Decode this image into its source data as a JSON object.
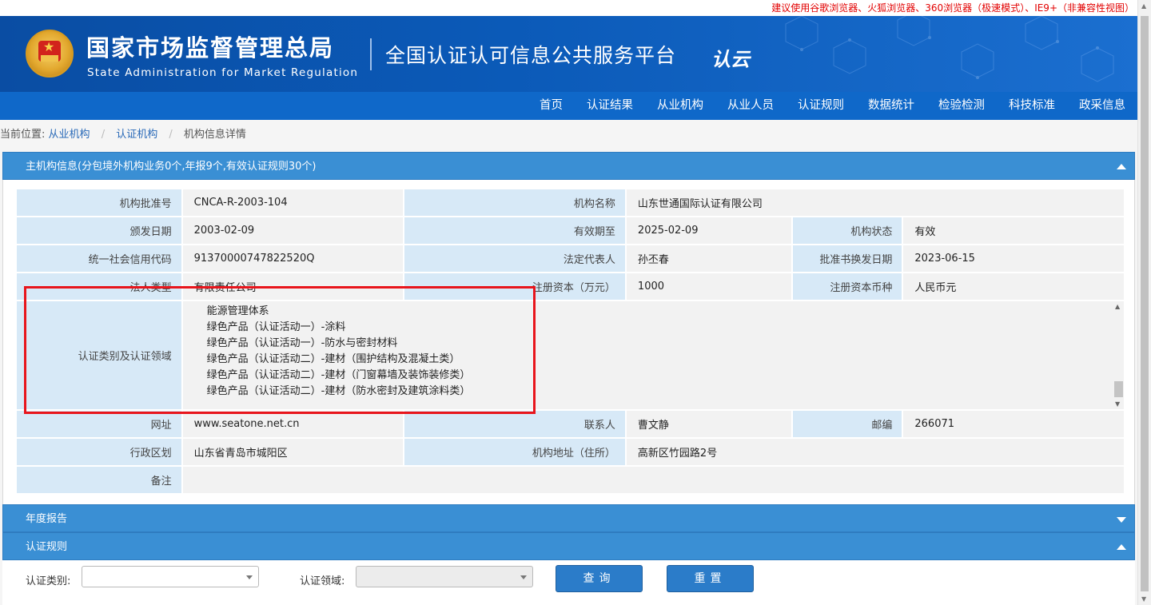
{
  "browser_notice": "建议使用谷歌浏览器、火狐浏览器、360浏览器（极速模式）、IE9+（非兼容性视图）",
  "header": {
    "org_name_cn": "国家市场监督管理总局",
    "org_name_en": "State Administration  for  Market Regulation",
    "platform_title": "全国认证认可信息公共服务平台",
    "cloud_logo": "认云"
  },
  "nav": {
    "items": [
      "首页",
      "认证结果",
      "从业机构",
      "从业人员",
      "认证规则",
      "数据统计",
      "检验检测",
      "科技标准",
      "政采信息"
    ]
  },
  "breadcrumb": {
    "prefix": "当前位置:",
    "items": [
      "从业机构",
      "认证机构",
      "机构信息详情"
    ]
  },
  "main_info": {
    "header": "主机构信息(分包境外机构业务0个,年报9个,有效认证规则30个)",
    "approval_no_label": "机构批准号",
    "approval_no": "CNCA-R-2003-104",
    "name_label": "机构名称",
    "name": "山东世通国际认证有限公司",
    "issue_date_label": "颁发日期",
    "issue_date": "2003-02-09",
    "valid_until_label": "有效期至",
    "valid_until": "2025-02-09",
    "status_label": "机构状态",
    "status": "有效",
    "credit_code_label": "统一社会信用代码",
    "credit_code": "91370000747822520Q",
    "legal_rep_label": "法定代表人",
    "legal_rep": "孙丕春",
    "renewal_date_label": "批准书换发日期",
    "renewal_date": "2023-06-15",
    "legal_type_label": "法人类型",
    "legal_type": "有限责任公司",
    "capital_label": "注册资本（万元）",
    "capital": "1000",
    "currency_label": "注册资本币种",
    "currency": "人民币元",
    "scope_label": "认证类别及认证领域",
    "scope_items": [
      "能源管理体系",
      "绿色产品（认证活动一）-涂料",
      "绿色产品（认证活动一）-防水与密封材料",
      "绿色产品（认证活动二）-建材（围护结构及混凝土类）",
      "绿色产品（认证活动二）-建材（门窗幕墙及装饰装修类）",
      "绿色产品（认证活动二）-建材（防水密封及建筑涂料类）"
    ],
    "website_label": "网址",
    "website": "www.seatone.net.cn",
    "contact_label": "联系人",
    "contact": "曹文静",
    "postcode_label": "邮编",
    "postcode": "266071",
    "region_label": "行政区划",
    "region": "山东省青岛市城阳区",
    "address_label": "机构地址（住所）",
    "address": "高新区竹园路2号",
    "remark_label": "备注",
    "remark": ""
  },
  "annual_report": {
    "header": "年度报告"
  },
  "cert_rules": {
    "header": "认证规则",
    "category_label": "认证类别:",
    "category_value": "",
    "field_label": "认证领域:",
    "field_value": "",
    "query_button": "查询",
    "reset_button": "重置"
  }
}
